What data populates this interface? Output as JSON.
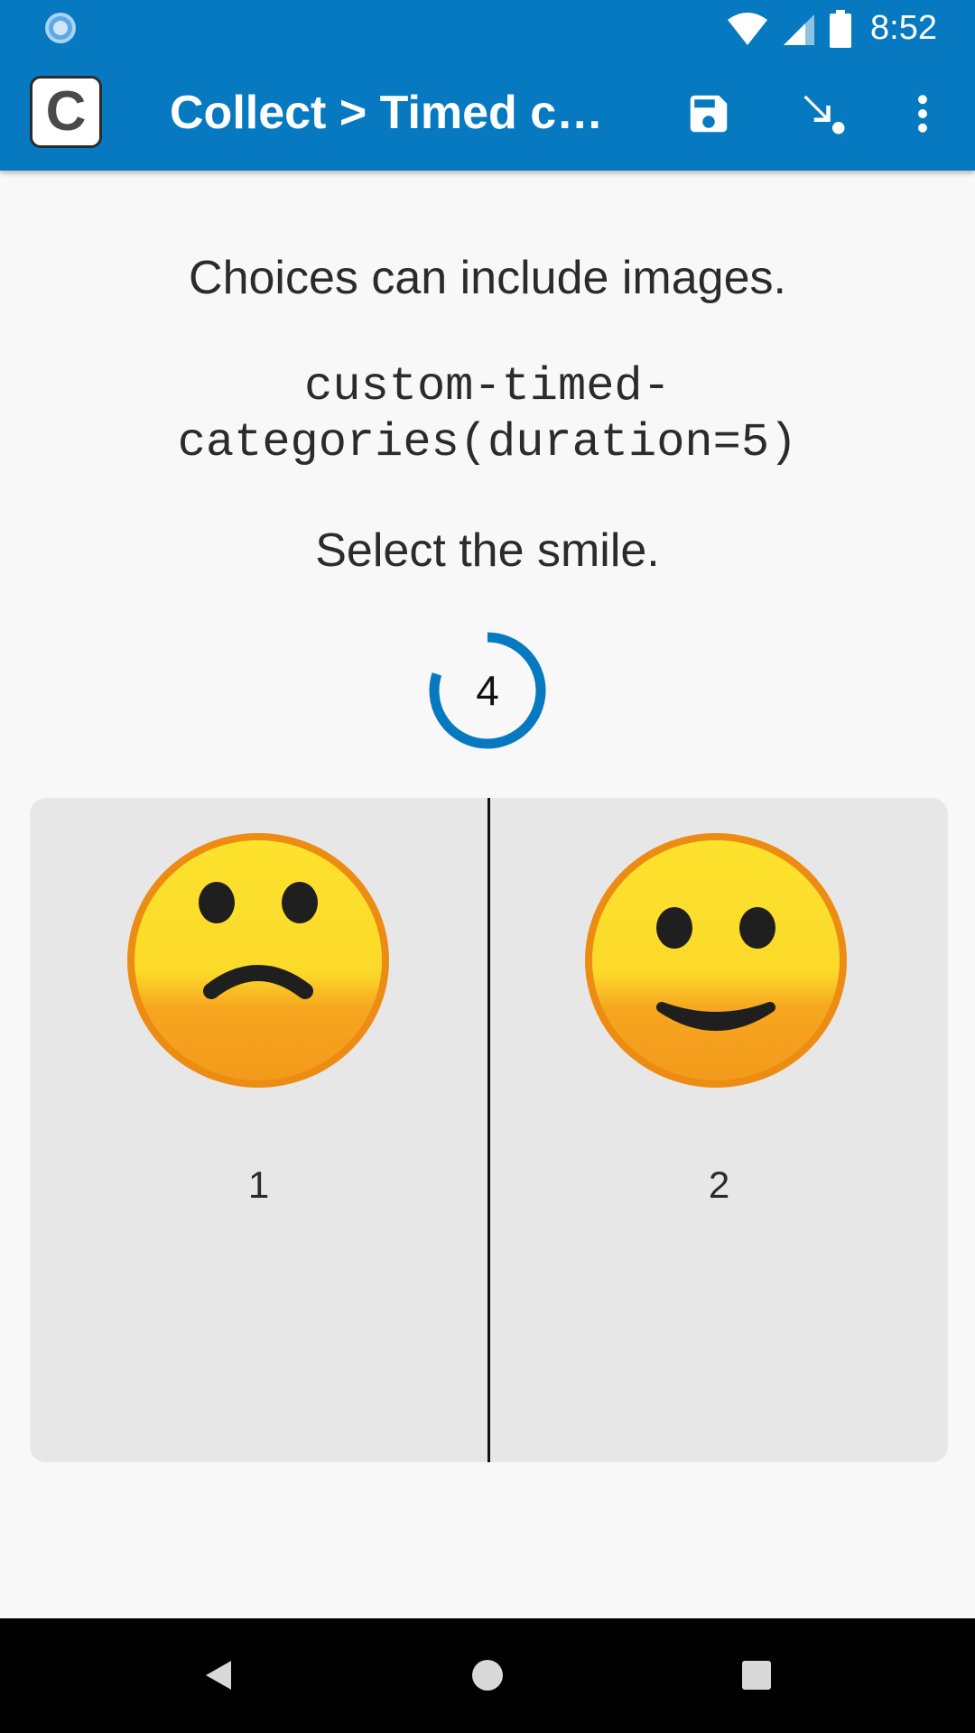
{
  "status_bar": {
    "time": "8:52",
    "icons": [
      "sync-spinner-icon",
      "wifi-icon",
      "signal-icon",
      "battery-icon"
    ]
  },
  "app_bar": {
    "logo_letter": "C",
    "title": "Collect > Timed categories",
    "actions": [
      "save-icon",
      "jump-icon",
      "more-vert-icon"
    ],
    "color": "#0679c1"
  },
  "question": {
    "label": "Choices can include images.",
    "appearance_line1": "custom-timed-",
    "appearance_line2": "categories(duration=5)",
    "hint": "Select the smile."
  },
  "timer": {
    "value": "4",
    "remaining_fraction": 0.8,
    "color": "#0679c1"
  },
  "choices": [
    {
      "label": "1",
      "icon": "frowning-face-icon"
    },
    {
      "label": "2",
      "icon": "smiling-face-icon"
    }
  ],
  "nav_bar": {
    "buttons": [
      "back-icon",
      "home-icon",
      "recents-icon"
    ]
  }
}
